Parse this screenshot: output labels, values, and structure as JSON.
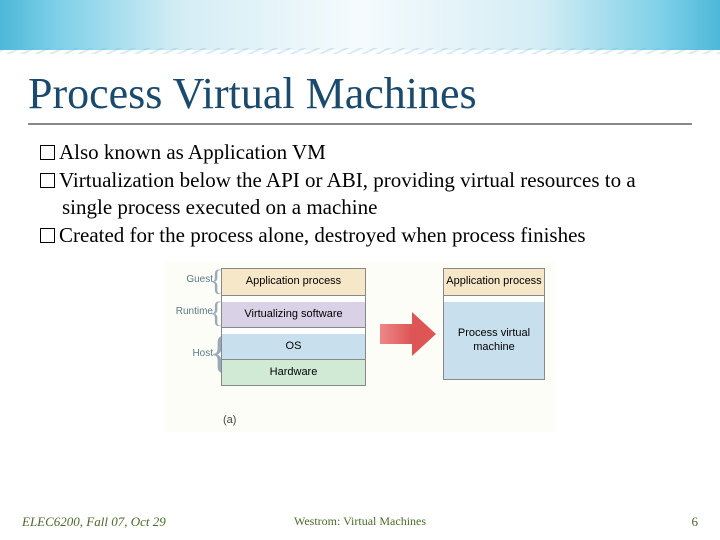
{
  "slide": {
    "title": "Process Virtual Machines",
    "bullets": [
      "Also known as Application VM",
      "Virtualization below the API or ABI, providing virtual resources to a single process executed on a machine",
      "Created for the process alone, destroyed when process finishes"
    ]
  },
  "diagram": {
    "left_labels": {
      "guest": "Guest",
      "runtime": "Runtime",
      "host": "Host"
    },
    "left_layers": {
      "app": "Application process",
      "virt": "Virtualizing software",
      "os": "OS",
      "hw": "Hardware"
    },
    "right_layers": {
      "app": "Application process",
      "pvm": "Process\nvirtual\nmachine"
    },
    "panel_label": "(a)"
  },
  "footer": {
    "left": "ELEC6200, Fall 07, Oct 29",
    "center": "Westrom: Virtual Machines",
    "page": "6"
  }
}
